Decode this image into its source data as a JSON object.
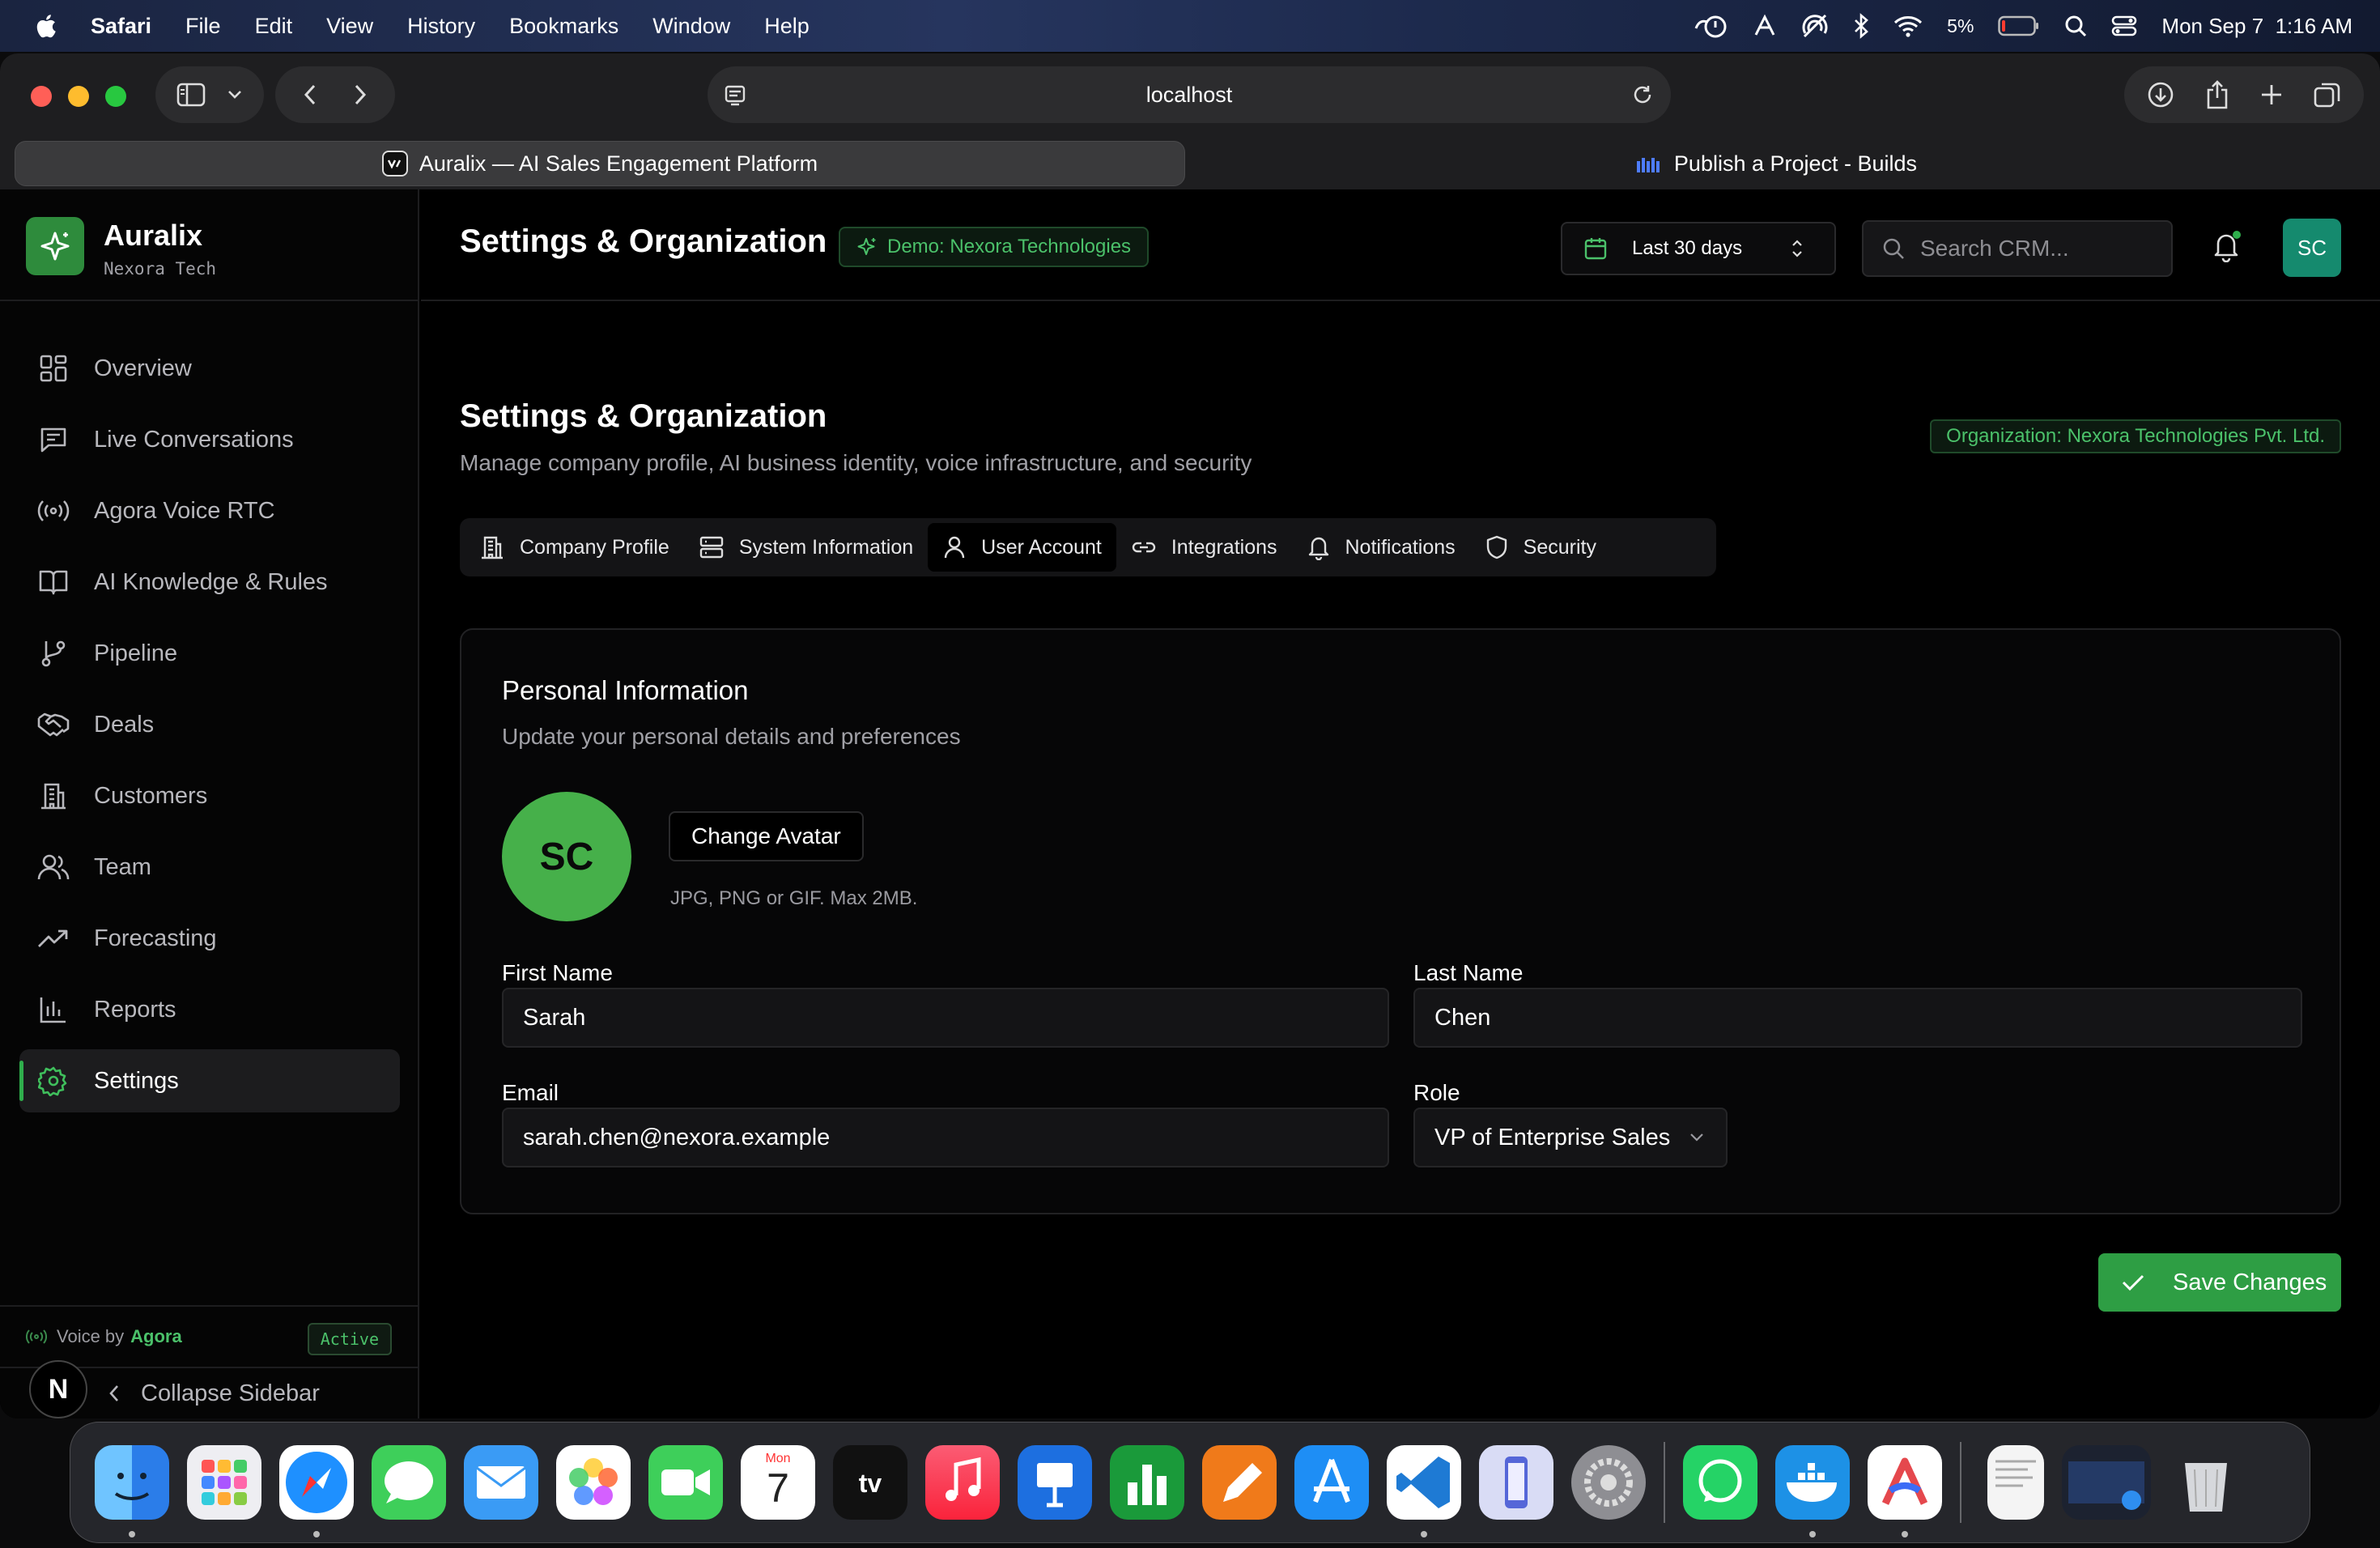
{
  "menubar": {
    "app": "Safari",
    "items": [
      "File",
      "Edit",
      "View",
      "History",
      "Bookmarks",
      "Window",
      "Help"
    ],
    "battery": "5%",
    "datetime": "Mon Sep 7  1:16 AM"
  },
  "browser": {
    "url": "localhost",
    "tabs": [
      {
        "title": "Auralix — AI Sales Engagement Platform"
      },
      {
        "title": "Publish a Project - Builds"
      }
    ]
  },
  "brand": {
    "name": "Auralix",
    "subtitle": "Nexora Tech"
  },
  "sidebar": {
    "items": [
      {
        "label": "Overview",
        "icon": "grid-icon"
      },
      {
        "label": "Live Conversations",
        "icon": "chat-icon"
      },
      {
        "label": "Agora Voice RTC",
        "icon": "broadcast-icon"
      },
      {
        "label": "AI Knowledge & Rules",
        "icon": "book-icon"
      },
      {
        "label": "Pipeline",
        "icon": "git-branch-icon"
      },
      {
        "label": "Deals",
        "icon": "handshake-icon"
      },
      {
        "label": "Customers",
        "icon": "building-icon"
      },
      {
        "label": "Team",
        "icon": "users-icon"
      },
      {
        "label": "Forecasting",
        "icon": "trend-up-icon"
      },
      {
        "label": "Reports",
        "icon": "bar-chart-icon"
      },
      {
        "label": "Settings",
        "icon": "gear-icon",
        "active": true
      }
    ],
    "voice_prefix": "Voice by",
    "voice_brand": "Agora",
    "voice_status": "Active",
    "collapse_label": "Collapse Sidebar",
    "logo_letter": "N"
  },
  "header": {
    "title": "Settings & Organization",
    "demo_badge": "Demo: Nexora Technologies",
    "date_range": "Last 30 days",
    "search_placeholder": "Search CRM...",
    "avatar_initials": "SC"
  },
  "page": {
    "title": "Settings & Organization",
    "subtitle": "Manage company profile, AI business identity, voice infrastructure, and security",
    "org_badge": "Organization: Nexora Technologies Pvt. Ltd.",
    "tabs": [
      {
        "label": "Company Profile",
        "icon": "building-icon"
      },
      {
        "label": "System Information",
        "icon": "server-icon"
      },
      {
        "label": "User Account",
        "icon": "user-icon",
        "active": true
      },
      {
        "label": "Integrations",
        "icon": "link-icon"
      },
      {
        "label": "Notifications",
        "icon": "bell-icon"
      },
      {
        "label": "Security",
        "icon": "shield-icon"
      }
    ]
  },
  "profile": {
    "title": "Personal Information",
    "subtitle": "Update your personal details and preferences",
    "avatar_initials": "SC",
    "change_avatar": "Change Avatar",
    "avatar_hint": "JPG, PNG or GIF. Max 2MB.",
    "first_name_label": "First Name",
    "first_name": "Sarah",
    "last_name_label": "Last Name",
    "last_name": "Chen",
    "email_label": "Email",
    "email": "sarah.chen@nexora.example",
    "role_label": "Role",
    "role": "VP of Enterprise Sales"
  },
  "actions": {
    "save": "Save Changes"
  },
  "colors": {
    "accent": "#2e9e44",
    "badge_text": "#4bc16a",
    "avatar_bg": "#158a6e"
  },
  "dock": {
    "apps": [
      "finder",
      "launchpad",
      "safari",
      "messages",
      "mail",
      "photos",
      "facetime",
      "calendar",
      "tv",
      "music",
      "keynote",
      "numbers",
      "pages",
      "app-store",
      "vscode",
      "simulator",
      "system-settings",
      "whatsapp",
      "docker",
      "arc"
    ],
    "calendar_month": "Mon",
    "calendar_day": "7"
  }
}
